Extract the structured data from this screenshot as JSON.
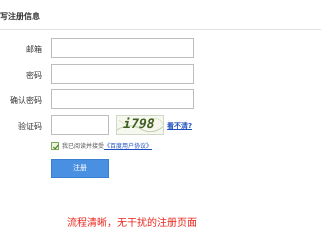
{
  "header": {
    "title": "写注册信息"
  },
  "form": {
    "email_label": "邮箱",
    "password_label": "密码",
    "confirm_label": "确认密码",
    "captcha_label": "验证码",
    "email_value": "",
    "password_value": "",
    "confirm_value": "",
    "captcha_value": "",
    "captcha_image_text": "i798",
    "refresh_link": "看不清?",
    "agree_prefix": "我已阅读并接受",
    "agree_link": "《百度用户协议》",
    "agree_checked": true,
    "register_button": "注册"
  },
  "caption": "流程清晰，无干扰的注册页面",
  "colors": {
    "accent_button": "#4a90e2",
    "link": "#1f4fbf",
    "caption": "#e8261c"
  }
}
